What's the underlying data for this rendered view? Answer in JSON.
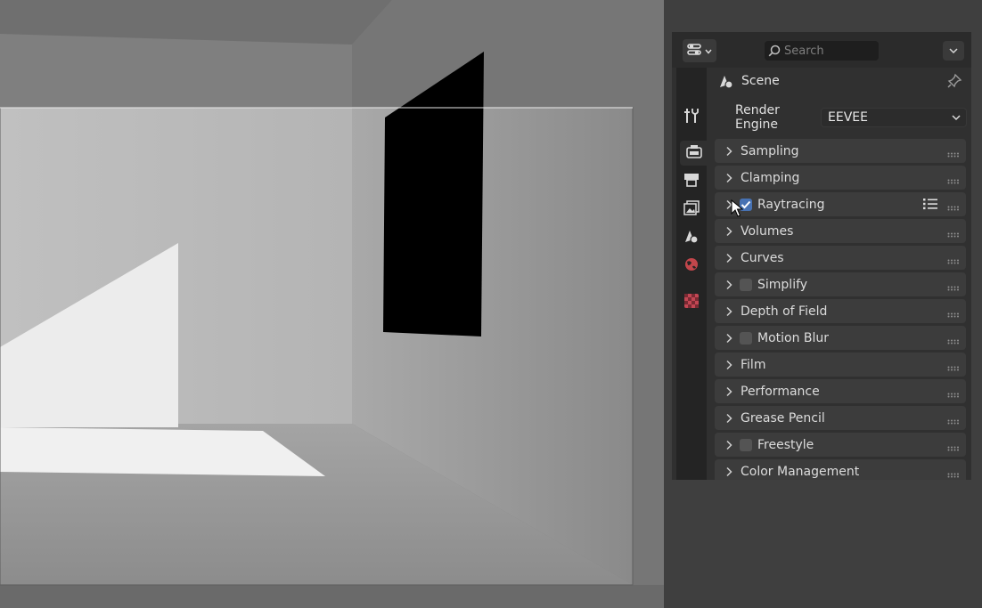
{
  "header": {
    "editor_type_icon": "properties-editor-icon",
    "search_placeholder": "Search",
    "options_icon": "chevron-down-icon"
  },
  "tabs": [
    {
      "name": "tool",
      "icon": "wrench-screwdriver-icon"
    },
    {
      "name": "render",
      "icon": "camera-back-icon",
      "active": true
    },
    {
      "name": "output",
      "icon": "printer-icon"
    },
    {
      "name": "view-layer",
      "icon": "image-stack-icon"
    },
    {
      "name": "scene",
      "icon": "scene-cone-sphere-icon"
    },
    {
      "name": "world",
      "icon": "globe-icon"
    },
    {
      "name": "texture",
      "icon": "checkerboard-icon"
    }
  ],
  "context": {
    "title": "Scene",
    "icon": "scene-icon",
    "pin_icon": "pin-icon"
  },
  "render_engine": {
    "label": "Render Engine",
    "value": "EEVEE"
  },
  "panels": [
    {
      "label": "Sampling",
      "has_checkbox": false
    },
    {
      "label": "Clamping",
      "has_checkbox": false
    },
    {
      "label": "Raytracing",
      "has_checkbox": true,
      "checked": true,
      "has_presets": true
    },
    {
      "label": "Volumes",
      "has_checkbox": false
    },
    {
      "label": "Curves",
      "has_checkbox": false
    },
    {
      "label": "Simplify",
      "has_checkbox": true,
      "checked": false
    },
    {
      "label": "Depth of Field",
      "has_checkbox": false
    },
    {
      "label": "Motion Blur",
      "has_checkbox": true,
      "checked": false
    },
    {
      "label": "Film",
      "has_checkbox": false
    },
    {
      "label": "Performance",
      "has_checkbox": false
    },
    {
      "label": "Grease Pencil",
      "has_checkbox": false
    },
    {
      "label": "Freestyle",
      "has_checkbox": true,
      "checked": false
    },
    {
      "label": "Color Management",
      "has_checkbox": false
    }
  ],
  "colors": {
    "checkbox_checked": "#4772b3",
    "panel_bg": "#3c3c3c",
    "editor_bg": "#303030"
  }
}
